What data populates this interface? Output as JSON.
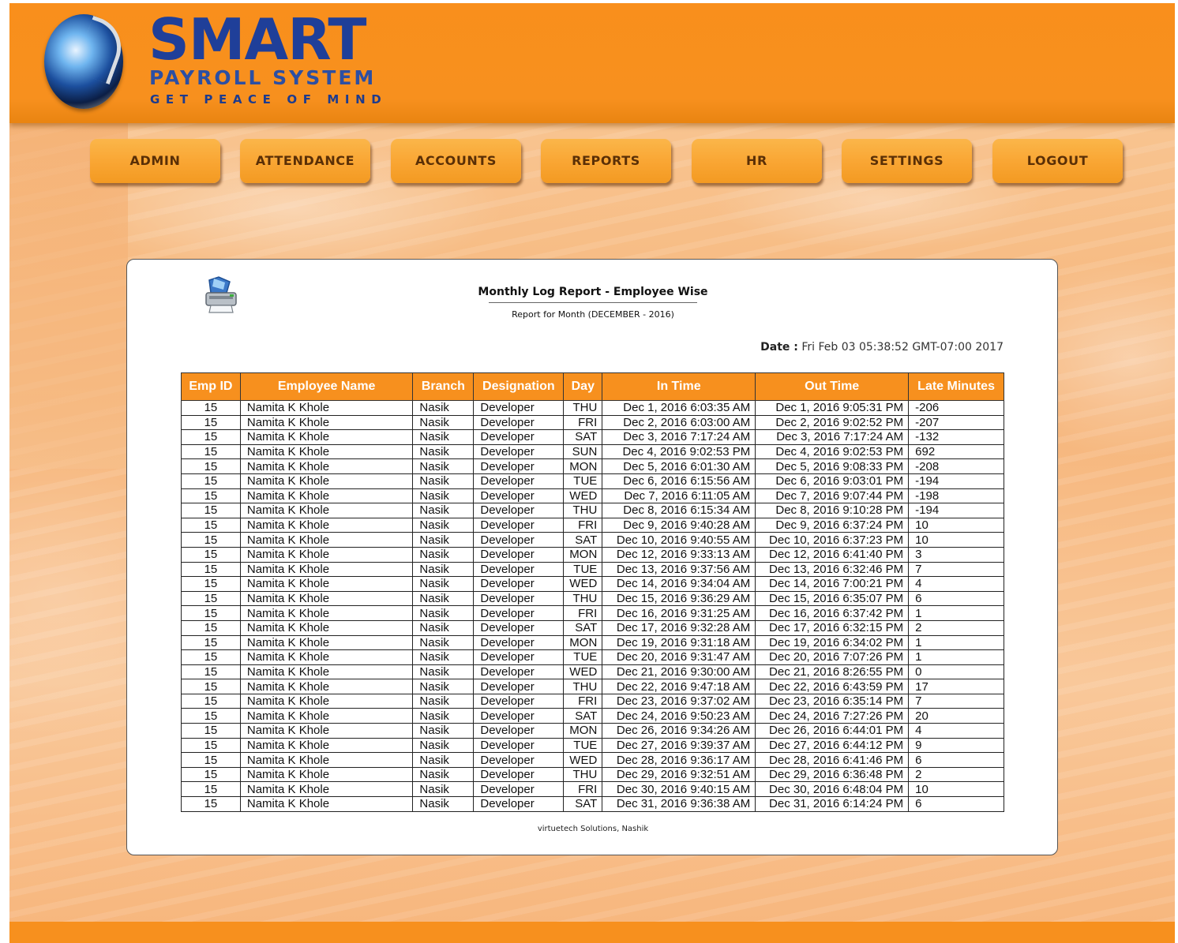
{
  "brand": {
    "title": "SMART",
    "subtitle": "PAYROLL SYSTEM",
    "tagline": "GET PEACE OF MIND"
  },
  "colors": {
    "header": "#f7901e",
    "nav_button": "#f9a532",
    "nav_text": "#5a2f06",
    "table_header": "#f7901e",
    "logo_text": "#1f3f99"
  },
  "nav": {
    "items": [
      {
        "label": "ADMIN"
      },
      {
        "label": "ATTENDANCE"
      },
      {
        "label": "ACCOUNTS"
      },
      {
        "label": "REPORTS"
      },
      {
        "label": "HR"
      },
      {
        "label": "SETTINGS"
      },
      {
        "label": "LOGOUT"
      }
    ]
  },
  "report": {
    "print_icon": "printer-icon",
    "title": "Monthly Log Report - Employee Wise",
    "subtitle": "Report for Month (DECEMBER - 2016)",
    "date_label": "Date :",
    "date_value": "Fri Feb 03 05:38:52 GMT-07:00 2017",
    "footer": "virtuetech Solutions, Nashik"
  },
  "table": {
    "columns": [
      "Emp ID",
      "Employee Name",
      "Branch",
      "Designation",
      "Day",
      "In Time",
      "Out Time",
      "Late Minutes"
    ],
    "rows": [
      [
        "15",
        "Namita K Khole",
        "Nasik",
        "Developer",
        "THU",
        "Dec 1, 2016 6:03:35 AM",
        "Dec 1, 2016 9:05:31 PM",
        "-206"
      ],
      [
        "15",
        "Namita K Khole",
        "Nasik",
        "Developer",
        "FRI",
        "Dec 2, 2016 6:03:00 AM",
        "Dec 2, 2016 9:02:52 PM",
        "-207"
      ],
      [
        "15",
        "Namita K Khole",
        "Nasik",
        "Developer",
        "SAT",
        "Dec 3, 2016 7:17:24 AM",
        "Dec 3, 2016 7:17:24 AM",
        "-132"
      ],
      [
        "15",
        "Namita K Khole",
        "Nasik",
        "Developer",
        "SUN",
        "Dec 4, 2016 9:02:53 PM",
        "Dec 4, 2016 9:02:53 PM",
        "692"
      ],
      [
        "15",
        "Namita K Khole",
        "Nasik",
        "Developer",
        "MON",
        "Dec 5, 2016 6:01:30 AM",
        "Dec 5, 2016 9:08:33 PM",
        "-208"
      ],
      [
        "15",
        "Namita K Khole",
        "Nasik",
        "Developer",
        "TUE",
        "Dec 6, 2016 6:15:56 AM",
        "Dec 6, 2016 9:03:01 PM",
        "-194"
      ],
      [
        "15",
        "Namita K Khole",
        "Nasik",
        "Developer",
        "WED",
        "Dec 7, 2016 6:11:05 AM",
        "Dec 7, 2016 9:07:44 PM",
        "-198"
      ],
      [
        "15",
        "Namita K Khole",
        "Nasik",
        "Developer",
        "THU",
        "Dec 8, 2016 6:15:34 AM",
        "Dec 8, 2016 9:10:28 PM",
        "-194"
      ],
      [
        "15",
        "Namita K Khole",
        "Nasik",
        "Developer",
        "FRI",
        "Dec 9, 2016 9:40:28 AM",
        "Dec 9, 2016 6:37:24 PM",
        "10"
      ],
      [
        "15",
        "Namita K Khole",
        "Nasik",
        "Developer",
        "SAT",
        "Dec 10, 2016 9:40:55 AM",
        "Dec 10, 2016 6:37:23 PM",
        "10"
      ],
      [
        "15",
        "Namita K Khole",
        "Nasik",
        "Developer",
        "MON",
        "Dec 12, 2016 9:33:13 AM",
        "Dec 12, 2016 6:41:40 PM",
        "3"
      ],
      [
        "15",
        "Namita K Khole",
        "Nasik",
        "Developer",
        "TUE",
        "Dec 13, 2016 9:37:56 AM",
        "Dec 13, 2016 6:32:46 PM",
        "7"
      ],
      [
        "15",
        "Namita K Khole",
        "Nasik",
        "Developer",
        "WED",
        "Dec 14, 2016 9:34:04 AM",
        "Dec 14, 2016 7:00:21 PM",
        "4"
      ],
      [
        "15",
        "Namita K Khole",
        "Nasik",
        "Developer",
        "THU",
        "Dec 15, 2016 9:36:29 AM",
        "Dec 15, 2016 6:35:07 PM",
        "6"
      ],
      [
        "15",
        "Namita K Khole",
        "Nasik",
        "Developer",
        "FRI",
        "Dec 16, 2016 9:31:25 AM",
        "Dec 16, 2016 6:37:42 PM",
        "1"
      ],
      [
        "15",
        "Namita K Khole",
        "Nasik",
        "Developer",
        "SAT",
        "Dec 17, 2016 9:32:28 AM",
        "Dec 17, 2016 6:32:15 PM",
        "2"
      ],
      [
        "15",
        "Namita K Khole",
        "Nasik",
        "Developer",
        "MON",
        "Dec 19, 2016 9:31:18 AM",
        "Dec 19, 2016 6:34:02 PM",
        "1"
      ],
      [
        "15",
        "Namita K Khole",
        "Nasik",
        "Developer",
        "TUE",
        "Dec 20, 2016 9:31:47 AM",
        "Dec 20, 2016 7:07:26 PM",
        "1"
      ],
      [
        "15",
        "Namita K Khole",
        "Nasik",
        "Developer",
        "WED",
        "Dec 21, 2016 9:30:00 AM",
        "Dec 21, 2016 8:26:55 PM",
        "0"
      ],
      [
        "15",
        "Namita K Khole",
        "Nasik",
        "Developer",
        "THU",
        "Dec 22, 2016 9:47:18 AM",
        "Dec 22, 2016 6:43:59 PM",
        "17"
      ],
      [
        "15",
        "Namita K Khole",
        "Nasik",
        "Developer",
        "FRI",
        "Dec 23, 2016 9:37:02 AM",
        "Dec 23, 2016 6:35:14 PM",
        "7"
      ],
      [
        "15",
        "Namita K Khole",
        "Nasik",
        "Developer",
        "SAT",
        "Dec 24, 2016 9:50:23 AM",
        "Dec 24, 2016 7:27:26 PM",
        "20"
      ],
      [
        "15",
        "Namita K Khole",
        "Nasik",
        "Developer",
        "MON",
        "Dec 26, 2016 9:34:26 AM",
        "Dec 26, 2016 6:44:01 PM",
        "4"
      ],
      [
        "15",
        "Namita K Khole",
        "Nasik",
        "Developer",
        "TUE",
        "Dec 27, 2016 9:39:37 AM",
        "Dec 27, 2016 6:44:12 PM",
        "9"
      ],
      [
        "15",
        "Namita K Khole",
        "Nasik",
        "Developer",
        "WED",
        "Dec 28, 2016 9:36:17 AM",
        "Dec 28, 2016 6:41:46 PM",
        "6"
      ],
      [
        "15",
        "Namita K Khole",
        "Nasik",
        "Developer",
        "THU",
        "Dec 29, 2016 9:32:51 AM",
        "Dec 29, 2016 6:36:48 PM",
        "2"
      ],
      [
        "15",
        "Namita K Khole",
        "Nasik",
        "Developer",
        "FRI",
        "Dec 30, 2016 9:40:15 AM",
        "Dec 30, 2016 6:48:04 PM",
        "10"
      ],
      [
        "15",
        "Namita K Khole",
        "Nasik",
        "Developer",
        "SAT",
        "Dec 31, 2016 9:36:38 AM",
        "Dec 31, 2016 6:14:24 PM",
        "6"
      ]
    ]
  }
}
